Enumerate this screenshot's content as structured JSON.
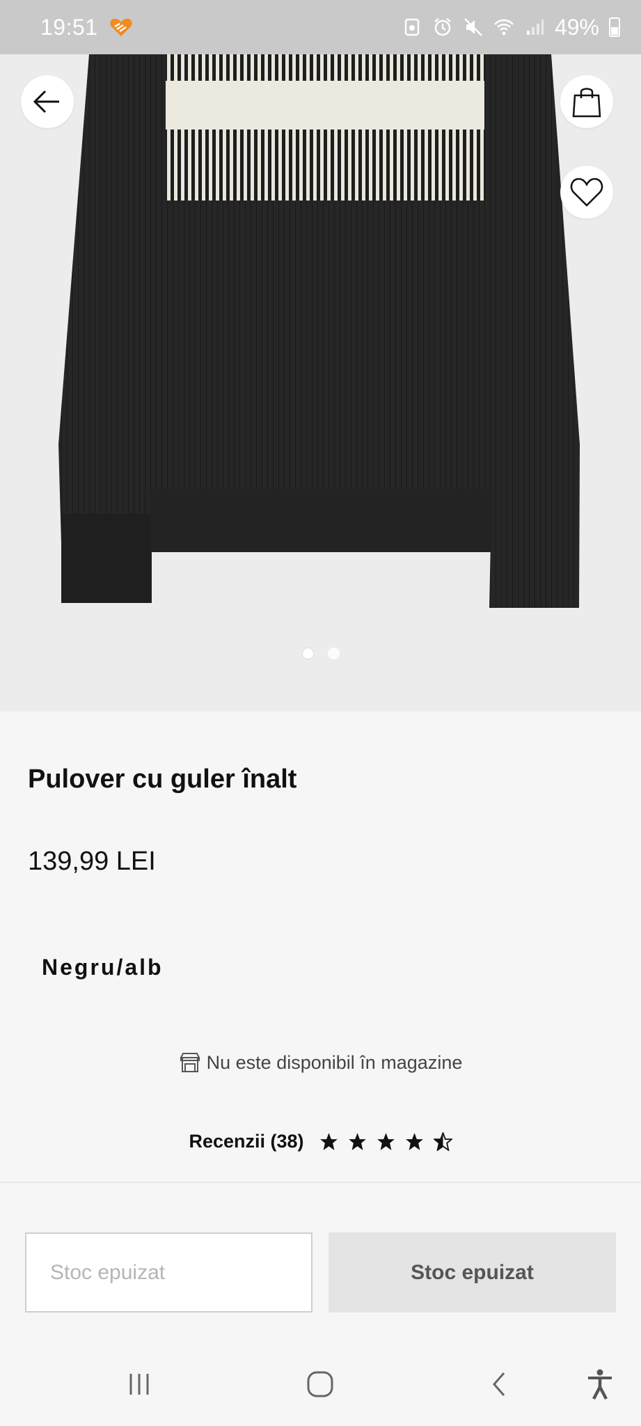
{
  "status_bar": {
    "time": "19:51",
    "battery": "49%",
    "icons": [
      "app-heart-badge-icon",
      "data-saver-icon",
      "alarm-icon",
      "mute-icon",
      "wifi-icon",
      "signal-icon",
      "battery-icon"
    ]
  },
  "hero": {
    "icons": [
      "back-arrow-icon",
      "shopping-bag-icon",
      "heart-icon"
    ],
    "image_dots": 2,
    "active_dot": 1
  },
  "product": {
    "title": "Pulover cu guler înalt",
    "price": "139,99 LEI",
    "color": "Negru/alb",
    "availability": "Nu este disponibil în magazine",
    "reviews_label": "Recenzii (38)",
    "rating": 4.5,
    "rating_max": 5
  },
  "actions": {
    "size_placeholder": "Stoc epuizat",
    "add_button": "Stoc epuizat"
  },
  "navbar": {
    "icons": [
      "recent-apps-icon",
      "home-icon",
      "back-icon",
      "accessibility-icon"
    ]
  }
}
